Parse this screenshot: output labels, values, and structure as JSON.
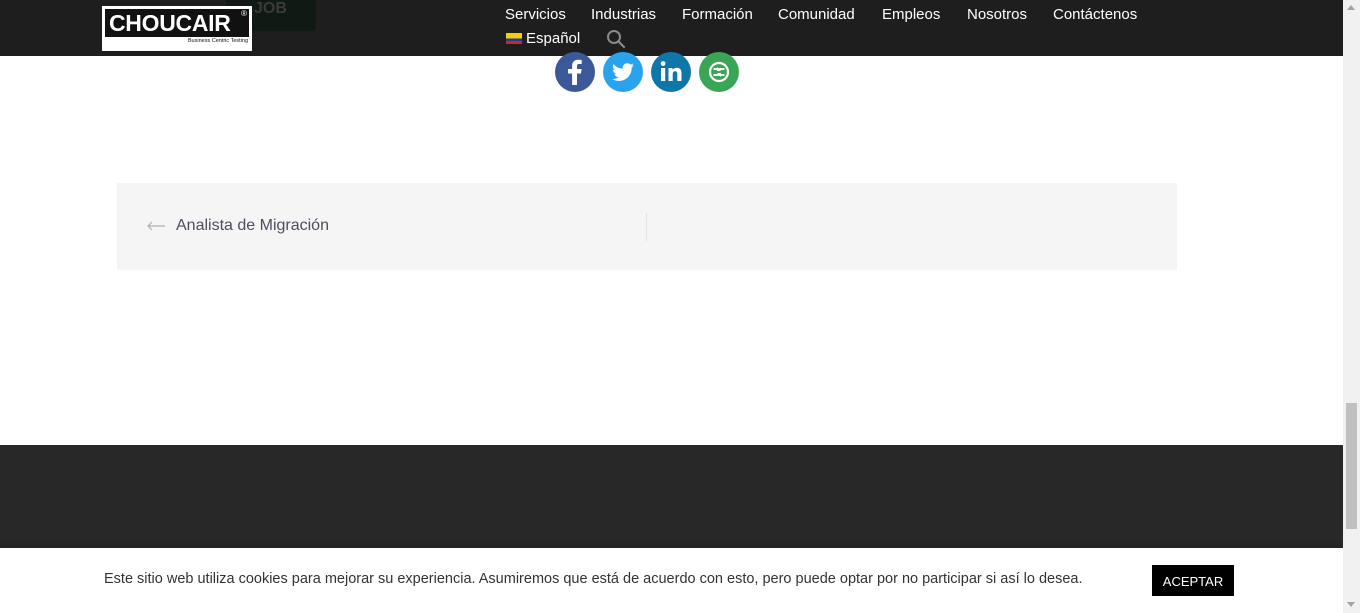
{
  "header": {
    "logo_text": "CHOUCAIR",
    "logo_mark": "®",
    "logo_tagline": "Business Centric Testing",
    "apply_button_partial": "JOB",
    "nav": [
      {
        "label": "Servicios"
      },
      {
        "label": "Industrias"
      },
      {
        "label": "Formación"
      },
      {
        "label": "Comunidad"
      },
      {
        "label": "Empleos"
      },
      {
        "label": "Nosotros"
      },
      {
        "label": "Contáctenos"
      }
    ],
    "language": "Español",
    "search_icon": "search-icon"
  },
  "share": {
    "buttons": [
      {
        "name": "facebook-icon",
        "color": "#3b5998"
      },
      {
        "name": "twitter-icon",
        "color": "#2aa3ef"
      },
      {
        "name": "linkedin-icon",
        "color": "#0e76a8"
      },
      {
        "name": "more-options-icon",
        "color": "#3aa655"
      }
    ]
  },
  "post_nav": {
    "prev_label": "Analista de Migración"
  },
  "cookie": {
    "text": "Este sitio web utiliza cookies para mejorar su experiencia. Asumiremos que está de acuerdo con esto, pero puede optar por no participar si así lo desea.",
    "accept": "ACEPTAR"
  },
  "colors": {
    "header_bg": "#1e1e1e",
    "footer_bg": "#282828",
    "post_nav_bg": "#f5f5f5"
  }
}
